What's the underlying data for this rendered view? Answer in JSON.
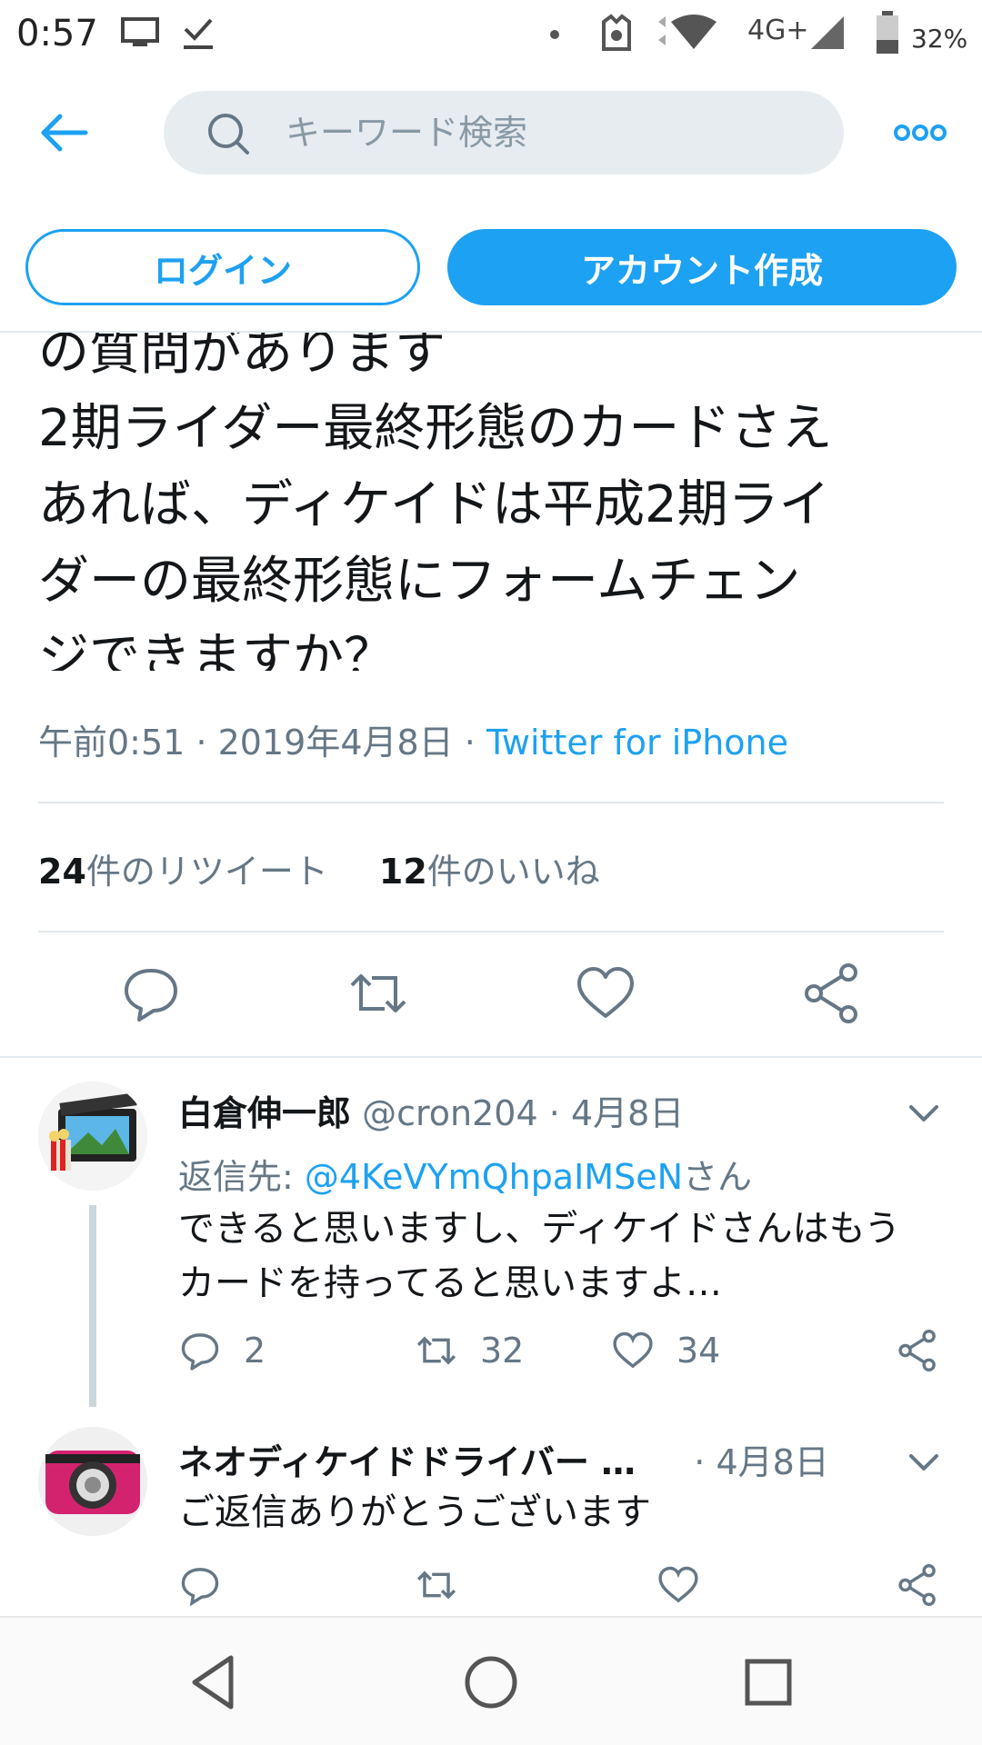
{
  "status_bar": {
    "time": "0:57",
    "network": "4G+",
    "battery": "32%"
  },
  "top_nav": {
    "search_placeholder": "キーワード検索"
  },
  "auth": {
    "login_label": "ログイン",
    "signup_label": "アカウント作成"
  },
  "tweet": {
    "lines": [
      "の質問があります",
      "2期ライダー最終形態のカードさえ",
      "あれば、ディケイドは平成2期ライ",
      "ダーの最終形態にフォームチェン",
      "ジできますか？"
    ],
    "time": "午前0:51",
    "date": "2019年4月8日",
    "separator": "·",
    "source": "Twitter for iPhone",
    "retweet_count": "24",
    "retweet_label": "件のリツイート",
    "like_count": "12",
    "like_label": "件のいいね"
  },
  "replies": [
    {
      "name": "白倉伸一郎",
      "handle": "@cron204",
      "sep": "·",
      "date": "4月8日",
      "reply_to_prefix": "返信先: ",
      "reply_to_mention": "@4KeVYmQhpaIMSeN",
      "reply_to_suffix": "さん",
      "text_lines": [
        "できると思いますし、ディケイドさんはもう",
        "カードを持ってると思いますよ…"
      ],
      "replies": "2",
      "retweets": "32",
      "likes": "34"
    },
    {
      "name": "ネオディケイドドライバー …",
      "sep": "·",
      "date": "4月8日",
      "text_lines": [
        "ご返信ありがとうございます"
      ]
    }
  ],
  "colors": {
    "accent": "#1da1f2",
    "secondary_text": "#657786",
    "divider": "#e1e8ed"
  }
}
